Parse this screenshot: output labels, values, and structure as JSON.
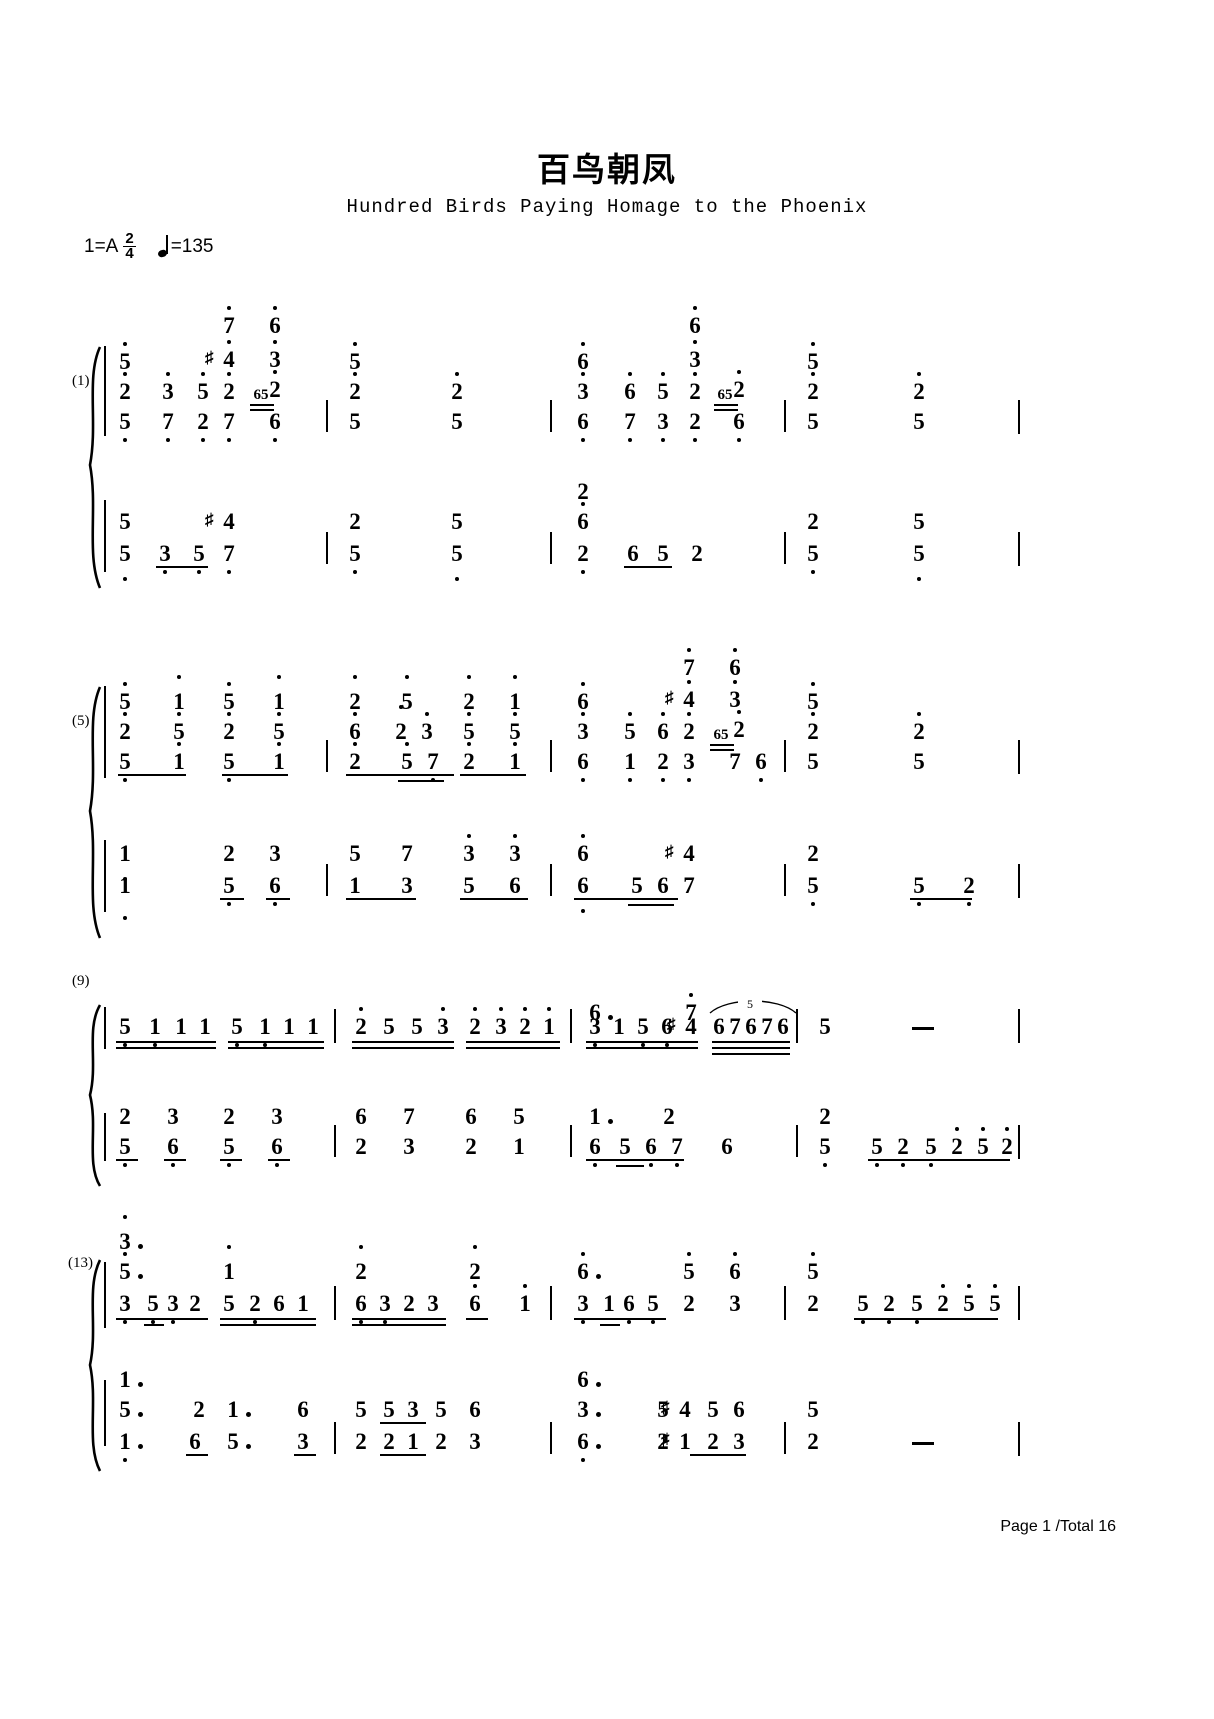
{
  "document": {
    "title_cn": "百鸟朝凤",
    "title_en": "Hundred Birds Paying Homage to the Phoenix",
    "key": "1=A",
    "time_signature": {
      "numerator": "2",
      "denominator": "4"
    },
    "tempo": "=135",
    "footer": "Page 1 /Total 16",
    "notation": "jianpu"
  },
  "systems": [
    {
      "measure_label": "(1)",
      "label_top": "(1)",
      "staves": [
        {
          "hand": "right",
          "voices": [
            {
              "tokens": [
                "5",
                "7",
                "6"
              ]
            },
            {
              "tokens": [
                "#4",
                "3"
              ]
            },
            {
              "tokens": [
                "5",
                "2",
                "3",
                "5",
                "2",
                "65",
                "2",
                "5",
                "2",
                "2",
                "6",
                "3",
                "6",
                "5",
                "2",
                "65",
                "2",
                "5",
                "2",
                "2"
              ]
            },
            {
              "tokens": [
                "5",
                "7",
                "2",
                "7",
                "6",
                "5",
                "5",
                "6",
                "7",
                "3",
                "2",
                "6",
                "6",
                "5",
                "5"
              ]
            }
          ]
        },
        {
          "hand": "left",
          "voices": [
            {
              "tokens": [
                "5",
                "#4",
                "2",
                "5",
                "2",
                "6",
                "2",
                "5"
              ]
            },
            {
              "tokens": [
                "5",
                "3",
                "5",
                "7",
                "5",
                "5",
                "2",
                "6",
                "5",
                "2",
                "5",
                "5"
              ]
            }
          ]
        }
      ]
    },
    {
      "measure_label": "(5)",
      "staves": [
        {
          "hand": "right",
          "voices": [
            {
              "tokens": [
                "5",
                "1",
                "5",
                "1",
                "2",
                "5",
                "2",
                "1",
                "6",
                "7",
                "6",
                "#4",
                "3",
                "5",
                "2"
              ]
            },
            {
              "tokens": [
                "2",
                "5",
                "2",
                "5",
                "6",
                "2",
                "3",
                "5",
                "5",
                "3",
                "5",
                "6",
                "2",
                "65",
                "2",
                "5"
              ]
            },
            {
              "tokens": [
                "5",
                "1",
                "5",
                "1",
                "2",
                "5",
                "7",
                "2",
                "1",
                "6",
                "1",
                "2",
                "3",
                "7",
                "6",
                "5",
                "2"
              ]
            }
          ]
        },
        {
          "hand": "left",
          "voices": [
            {
              "tokens": [
                "1",
                "2",
                "3",
                "5",
                "7",
                "3",
                "3",
                "6",
                "#4",
                "2",
                "5"
              ]
            },
            {
              "tokens": [
                "1",
                "5",
                "6",
                "1",
                "3",
                "5",
                "6",
                "6",
                "5",
                "6",
                "7",
                "5",
                "5",
                "2"
              ]
            }
          ]
        }
      ]
    },
    {
      "measure_label": "(9)",
      "staves": [
        {
          "hand": "right",
          "voices": [
            {
              "tokens": [
                "5",
                "1",
                "1",
                "1",
                "5",
                "1",
                "1",
                "1",
                "2",
                "5",
                "5",
                "3",
                "2",
                "3",
                "2",
                "1",
                "3",
                "1",
                "5",
                "6",
                "#4",
                "6",
                "7",
                "6",
                "7",
                "6",
                "5"
              ]
            }
          ]
        },
        {
          "hand": "left",
          "voices": [
            {
              "tokens": [
                "2",
                "3",
                "2",
                "3",
                "6",
                "7",
                "6",
                "5",
                "1",
                "2",
                "2"
              ]
            },
            {
              "tokens": [
                "5",
                "6",
                "5",
                "6",
                "2",
                "3",
                "2",
                "1",
                "6",
                "5",
                "6",
                "7",
                "6",
                "5",
                "5",
                "2",
                "5",
                "2",
                "5",
                "2"
              ]
            }
          ]
        }
      ]
    },
    {
      "measure_label": "(13)",
      "staves": [
        {
          "hand": "right",
          "voices": [
            {
              "tokens": [
                "3",
                "5",
                "1",
                "2",
                "2",
                "6",
                "5",
                "6",
                "5"
              ]
            },
            {
              "tokens": [
                "3",
                "5",
                "3",
                "2",
                "5",
                "2",
                "6",
                "1",
                "6",
                "3",
                "2",
                "3",
                "6",
                "1",
                "3",
                "1",
                "6",
                "5",
                "2",
                "3",
                "2",
                "5",
                "2",
                "5",
                "2",
                "5",
                "5"
              ]
            }
          ]
        },
        {
          "hand": "left",
          "voices": [
            {
              "tokens": [
                "1",
                "5",
                "2",
                "1",
                "6",
                "6",
                "3",
                "5",
                "#4",
                "5",
                "6",
                "5"
              ]
            },
            {
              "tokens": [
                "1",
                "6",
                "5",
                "3",
                "2",
                "5",
                "3",
                "5",
                "6",
                "2",
                "2",
                "1",
                "2",
                "3",
                "6",
                "2",
                "#1",
                "2",
                "3",
                "2"
              ]
            }
          ]
        }
      ]
    }
  ],
  "marks": {
    "sharp": "♯",
    "dash": "–",
    "tuplet5": "5",
    "bar": "|"
  }
}
